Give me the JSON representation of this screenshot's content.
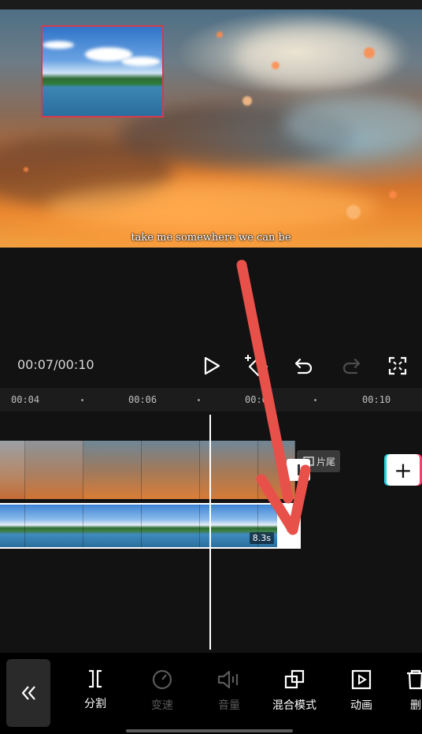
{
  "preview": {
    "subtitle": "take me somewhere we can be"
  },
  "player": {
    "time_display": "00:07/00:10",
    "icons": [
      "play-icon",
      "keyframe-add-icon",
      "undo-icon",
      "redo-icon",
      "fullscreen-icon"
    ]
  },
  "ruler": {
    "ticks": [
      "00:04",
      "00:06",
      "00:08",
      "00:10"
    ]
  },
  "timeline": {
    "end_chip_label": "片尾",
    "pip_duration": "8.3s",
    "add_button": "+"
  },
  "toolbar": {
    "collapse_icon": "double-chevron-left-icon",
    "items": [
      {
        "label": "分割",
        "icon": "split-icon",
        "enabled": true
      },
      {
        "label": "变速",
        "icon": "speed-icon",
        "enabled": false
      },
      {
        "label": "音量",
        "icon": "volume-icon",
        "enabled": false
      },
      {
        "label": "混合模式",
        "icon": "blend-mode-icon",
        "enabled": true
      },
      {
        "label": "动画",
        "icon": "animation-icon",
        "enabled": true
      },
      {
        "label": "删",
        "icon": "delete-icon",
        "enabled": true
      }
    ]
  },
  "colors": {
    "annotation_arrow": "#e8504a",
    "pip_border": "#d13c52",
    "add_button_left_accent": "#1fd4e0",
    "add_button_right_accent": "#ff3c6a"
  }
}
